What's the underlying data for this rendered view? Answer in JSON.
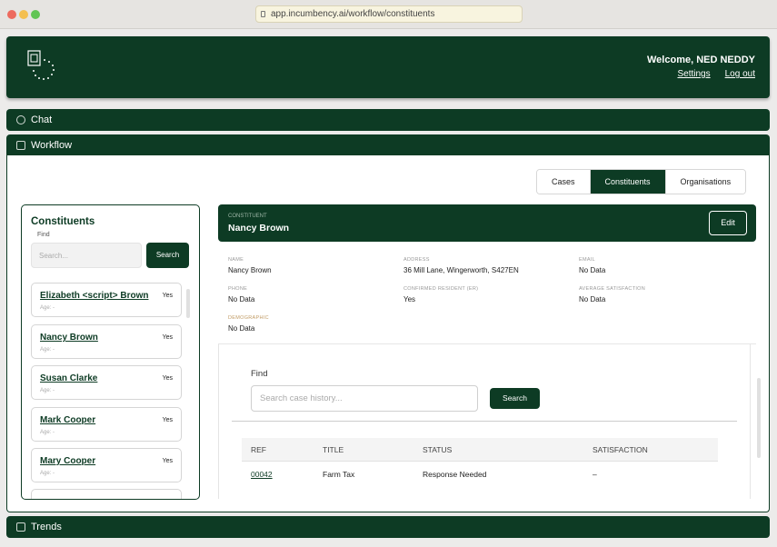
{
  "browser": {
    "url": "app.incumbency.ai/workflow/constituents"
  },
  "header": {
    "welcome": "Welcome, NED NEDDY",
    "settings": "Settings",
    "logout": "Log out"
  },
  "sections": {
    "chat": "Chat",
    "workflow": "Workflow",
    "trends": "Trends"
  },
  "tabs": [
    {
      "label": "Cases",
      "active": false
    },
    {
      "label": "Constituents",
      "active": true
    },
    {
      "label": "Organisations",
      "active": false
    }
  ],
  "constituents": {
    "title": "Constituents",
    "find_label": "Find",
    "search_placeholder": "Search...",
    "search_button": "Search",
    "items": [
      {
        "name": "Elizabeth <script> Brown",
        "age": "Age: -",
        "resident": "Yes"
      },
      {
        "name": "Nancy Brown",
        "age": "Age: -",
        "resident": "Yes"
      },
      {
        "name": "Susan Clarke",
        "age": "Age: -",
        "resident": "Yes"
      },
      {
        "name": "Mark Cooper",
        "age": "Age: -",
        "resident": "Yes"
      },
      {
        "name": "Mary Cooper",
        "age": "Age: -",
        "resident": "Yes"
      }
    ]
  },
  "detail": {
    "label": "CONSTITUENT",
    "name": "Nancy Brown",
    "edit": "Edit",
    "fields": {
      "name_k": "NAME",
      "name_v": "Nancy Brown",
      "address_k": "ADDRESS",
      "address_v": "36 Mill Lane, Wingerworth, S427EN",
      "email_k": "EMAIL",
      "email_v": "No Data",
      "phone_k": "PHONE",
      "phone_v": "No Data",
      "resident_k": "CONFIRMED RESIDENT (ER)",
      "resident_v": "Yes",
      "satisfaction_k": "AVERAGE SATISFACTION",
      "satisfaction_v": "No Data",
      "demographic_k": "DEMOGRAPHIC",
      "demographic_v": "No Data"
    }
  },
  "history": {
    "find_label": "Find",
    "search_placeholder": "Search case history...",
    "search_button": "Search",
    "columns": [
      "REF",
      "TITLE",
      "STATUS",
      "SATISFACTION"
    ],
    "rows": [
      {
        "ref": "00042",
        "title": "Farm Tax",
        "status": "Response Needed",
        "satisfaction": "–"
      }
    ]
  }
}
